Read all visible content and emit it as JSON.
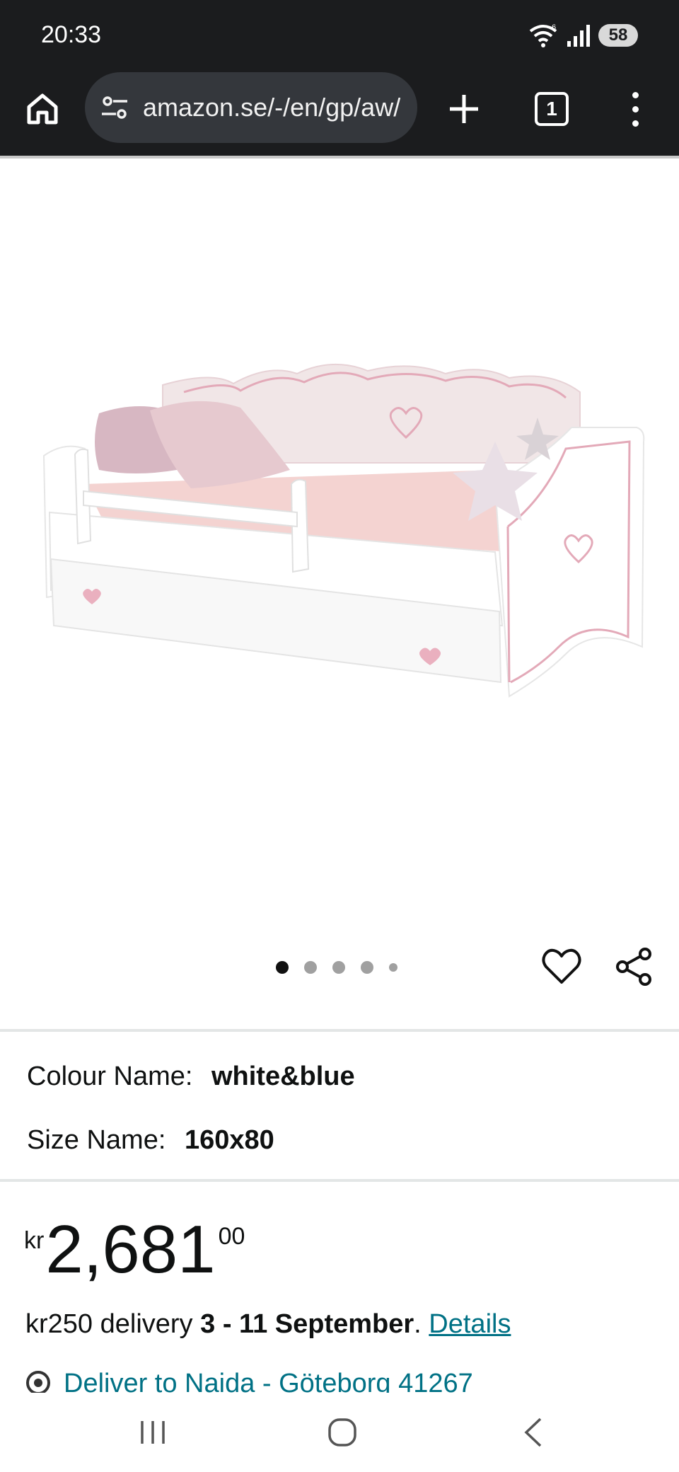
{
  "status_bar": {
    "time": "20:33",
    "battery": "58",
    "icons": [
      "wifi-icon",
      "signal-icon",
      "battery-icon"
    ]
  },
  "browser": {
    "url": "amazon.se/-/en/gp/aw/",
    "tab_count": "1",
    "icons": [
      "home-icon",
      "site-settings-icon",
      "new-tab-icon",
      "tab-switcher-icon",
      "more-menu-icon"
    ]
  },
  "product": {
    "image_description_icon": "daybed-image",
    "carousel": {
      "total": 5,
      "active": 0
    }
  },
  "variants": {
    "colour_label": "Colour Name:",
    "colour_value": "white&blue",
    "size_label": "Size Name:",
    "size_value": "160x80"
  },
  "price": {
    "currency": "kr",
    "whole": "2,681",
    "fraction": "00"
  },
  "delivery": {
    "prefix": "kr250 delivery ",
    "dates": "3 - 11 September",
    "suffix": ". ",
    "details_link": "Details"
  },
  "deliver_to": {
    "text": "Deliver to Naida - Göteborg 41267"
  },
  "colors": {
    "link": "#007185",
    "chrome_dark": "#1b1c1e",
    "url_box": "#34373c"
  }
}
